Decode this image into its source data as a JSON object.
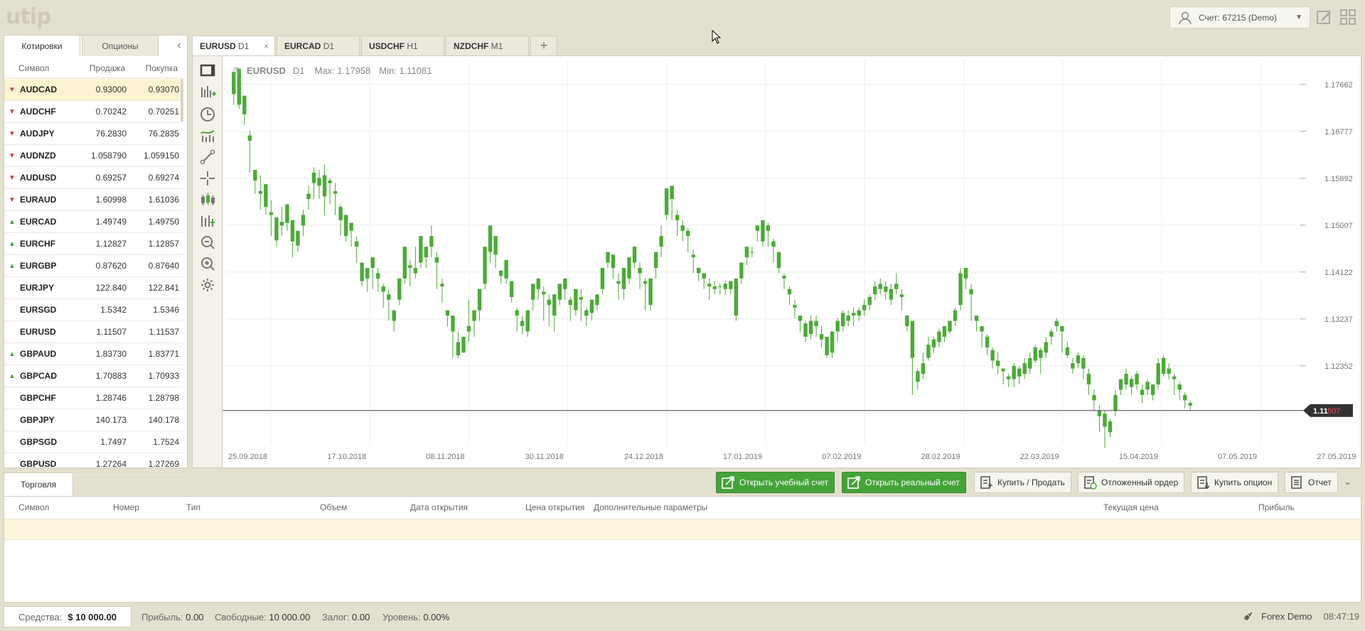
{
  "app": {
    "logo": "utip"
  },
  "account": {
    "label": "Счет: 67215 (Demo)"
  },
  "left_tabs": [
    "Котировки",
    "Опционы"
  ],
  "quotes_header": {
    "symbol": "Символ",
    "sell": "Продажа",
    "buy": "Покупка"
  },
  "quotes": [
    {
      "symbol": "AUDCAD",
      "sell": "0.93000",
      "buy": "0.93070",
      "dir": "down"
    },
    {
      "symbol": "AUDCHF",
      "sell": "0.70242",
      "buy": "0.70251",
      "dir": "down"
    },
    {
      "symbol": "AUDJPY",
      "sell": "76.2830",
      "buy": "76.2835",
      "dir": "down"
    },
    {
      "symbol": "AUDNZD",
      "sell": "1.058790",
      "buy": "1.059150",
      "dir": "down"
    },
    {
      "symbol": "AUDUSD",
      "sell": "0.69257",
      "buy": "0.69274",
      "dir": "down"
    },
    {
      "symbol": "EURAUD",
      "sell": "1.60998",
      "buy": "1.61036",
      "dir": "down"
    },
    {
      "symbol": "EURCAD",
      "sell": "1.49749",
      "buy": "1.49750",
      "dir": "up"
    },
    {
      "symbol": "EURCHF",
      "sell": "1.12827",
      "buy": "1.12857",
      "dir": "up"
    },
    {
      "symbol": "EURGBP",
      "sell": "0.87620",
      "buy": "0.87640",
      "dir": "up"
    },
    {
      "symbol": "EURJPY",
      "sell": "122.840",
      "buy": "122.841",
      "dir": ""
    },
    {
      "symbol": "EURSGD",
      "sell": "1.5342",
      "buy": "1.5346",
      "dir": ""
    },
    {
      "symbol": "EURUSD",
      "sell": "1.11507",
      "buy": "1.11537",
      "dir": ""
    },
    {
      "symbol": "GBPAUD",
      "sell": "1.83730",
      "buy": "1.83771",
      "dir": "up"
    },
    {
      "symbol": "GBPCAD",
      "sell": "1.70883",
      "buy": "1.70933",
      "dir": "up"
    },
    {
      "symbol": "GBPCHF",
      "sell": "1.28746",
      "buy": "1.28798",
      "dir": ""
    },
    {
      "symbol": "GBPJPY",
      "sell": "140.173",
      "buy": "140.178",
      "dir": ""
    },
    {
      "symbol": "GBPSGD",
      "sell": "1.7497",
      "buy": "1.7524",
      "dir": ""
    },
    {
      "symbol": "GBPUSD",
      "sell": "1.27264",
      "buy": "1.27269",
      "dir": ""
    }
  ],
  "chart_tabs": [
    {
      "symbol": "EURUSD",
      "tf": "D1"
    },
    {
      "symbol": "EURCAD",
      "tf": "D1"
    },
    {
      "symbol": "USDCHF",
      "tf": "H1"
    },
    {
      "symbol": "NZDCHF",
      "tf": "M1"
    }
  ],
  "chart_tab_close": "×",
  "chart_tab_add": "+",
  "chart_header": {
    "symbol": "EURUSD",
    "tf": "D1",
    "max": "Max: 1.17958",
    "min": "Min: 1.11081"
  },
  "current_price": {
    "main": "1.11",
    "pips": "507",
    "value": 1.11507
  },
  "chart_data": {
    "type": "candlestick",
    "symbol": "EURUSD",
    "timeframe": "D1",
    "ylim": [
      1.1086,
      1.1813
    ],
    "y_ticks": [
      "1.17662",
      "1.16777",
      "1.15892",
      "1.15007",
      "1.14122",
      "1.13237",
      "1.12352"
    ],
    "x_ticks": [
      "25.09.2018",
      "17.10.2018",
      "08.11.2018",
      "30.11.2018",
      "24.12.2018",
      "17.01.2019",
      "07.02.2019",
      "28.02.2019",
      "22.03.2019",
      "15.04.2019",
      "07.05.2019",
      "27.05.2019"
    ],
    "candles": [
      [
        1.1748,
        1.179,
        1.174,
        1.1728
      ],
      [
        1.1728,
        1.1796,
        1.1736,
        1.172
      ],
      [
        1.171,
        1.1745,
        1.174,
        1.169
      ],
      [
        1.166,
        1.167,
        1.1679,
        1.16
      ],
      [
        1.1585,
        1.1605,
        1.1602,
        1.156
      ],
      [
        1.156,
        1.1565,
        1.1595,
        1.153
      ],
      [
        1.1535,
        1.1578,
        1.1545,
        1.152
      ],
      [
        1.152,
        1.1525,
        1.1548,
        1.148
      ],
      [
        1.1472,
        1.1515,
        1.1475,
        1.146
      ],
      [
        1.15,
        1.1507,
        1.1535,
        1.148
      ],
      [
        1.1505,
        1.154,
        1.151,
        1.149
      ],
      [
        1.147,
        1.151,
        1.1485,
        1.144
      ],
      [
        1.1462,
        1.149,
        1.1475,
        1.145
      ],
      [
        1.15,
        1.152,
        1.153,
        1.148
      ],
      [
        1.155,
        1.156,
        1.1575,
        1.153
      ],
      [
        1.158,
        1.16,
        1.161,
        1.155
      ],
      [
        1.1575,
        1.159,
        1.1605,
        1.155
      ],
      [
        1.1555,
        1.1595,
        1.1615,
        1.152
      ],
      [
        1.158,
        1.1585,
        1.159,
        1.154
      ],
      [
        1.156,
        1.1565,
        1.158,
        1.152
      ],
      [
        1.151,
        1.1535,
        1.154,
        1.148
      ],
      [
        1.148,
        1.152,
        1.1495,
        1.147
      ],
      [
        1.149,
        1.1505,
        1.1495,
        1.146
      ],
      [
        1.146,
        1.147,
        1.148,
        1.143
      ],
      [
        1.1395,
        1.143,
        1.143,
        1.1385
      ],
      [
        1.14,
        1.142,
        1.1405,
        1.1375
      ],
      [
        1.142,
        1.144,
        1.142,
        1.138
      ],
      [
        1.14,
        1.141,
        1.142,
        1.1375
      ],
      [
        1.1375,
        1.1385,
        1.139,
        1.1345
      ],
      [
        1.136,
        1.137,
        1.138,
        1.132
      ],
      [
        1.132,
        1.134,
        1.133,
        1.13
      ],
      [
        1.136,
        1.14,
        1.1365,
        1.135
      ],
      [
        1.14,
        1.146,
        1.141,
        1.139
      ],
      [
        1.142,
        1.1425,
        1.1435,
        1.1385
      ],
      [
        1.141,
        1.142,
        1.146,
        1.14
      ],
      [
        1.143,
        1.148,
        1.1435,
        1.142
      ],
      [
        1.144,
        1.146,
        1.1455,
        1.142
      ],
      [
        1.146,
        1.148,
        1.15,
        1.144
      ],
      [
        1.143,
        1.144,
        1.145,
        1.138
      ],
      [
        1.1385,
        1.139,
        1.14,
        1.1355
      ],
      [
        1.133,
        1.134,
        1.134,
        1.131
      ],
      [
        1.13,
        1.133,
        1.131,
        1.125
      ],
      [
        1.1255,
        1.128,
        1.13,
        1.125
      ],
      [
        1.126,
        1.129,
        1.127,
        1.126
      ],
      [
        1.13,
        1.131,
        1.136,
        1.128
      ],
      [
        1.132,
        1.134,
        1.133,
        1.129
      ],
      [
        1.134,
        1.138,
        1.135,
        1.132
      ],
      [
        1.139,
        1.146,
        1.14,
        1.138
      ],
      [
        1.145,
        1.15,
        1.1455,
        1.143
      ],
      [
        1.1445,
        1.148,
        1.145,
        1.142
      ],
      [
        1.1405,
        1.1415,
        1.1415,
        1.139
      ],
      [
        1.14,
        1.1435,
        1.142,
        1.139
      ],
      [
        1.1365,
        1.1395,
        1.138,
        1.1355
      ],
      [
        1.133,
        1.134,
        1.1345,
        1.13
      ],
      [
        1.131,
        1.132,
        1.133,
        1.1295
      ],
      [
        1.13,
        1.134,
        1.131,
        1.129
      ],
      [
        1.136,
        1.139,
        1.137,
        1.134
      ],
      [
        1.138,
        1.14,
        1.139,
        1.136
      ],
      [
        1.137,
        1.1375,
        1.1385,
        1.132
      ],
      [
        1.135,
        1.136,
        1.137,
        1.131
      ],
      [
        1.133,
        1.137,
        1.134,
        1.13
      ],
      [
        1.136,
        1.139,
        1.1375,
        1.135
      ],
      [
        1.138,
        1.14,
        1.139,
        1.136
      ],
      [
        1.135,
        1.136,
        1.1365,
        1.132
      ],
      [
        1.134,
        1.138,
        1.135,
        1.133
      ],
      [
        1.136,
        1.1365,
        1.138,
        1.132
      ],
      [
        1.133,
        1.134,
        1.1345,
        1.131
      ],
      [
        1.1335,
        1.136,
        1.134,
        1.132
      ],
      [
        1.135,
        1.137,
        1.137,
        1.134
      ],
      [
        1.138,
        1.142,
        1.1395,
        1.137
      ],
      [
        1.143,
        1.145,
        1.144,
        1.142
      ],
      [
        1.142,
        1.1445,
        1.143,
        1.14
      ],
      [
        1.139,
        1.1395,
        1.141,
        1.136
      ],
      [
        1.138,
        1.142,
        1.139,
        1.136
      ],
      [
        1.14,
        1.144,
        1.141,
        1.139
      ],
      [
        1.143,
        1.146,
        1.144,
        1.142
      ],
      [
        1.141,
        1.142,
        1.143,
        1.138
      ],
      [
        1.139,
        1.1395,
        1.14,
        1.134
      ],
      [
        1.135,
        1.14,
        1.136,
        1.134
      ],
      [
        1.142,
        1.145,
        1.143,
        1.14
      ],
      [
        1.146,
        1.148,
        1.15,
        1.144
      ],
      [
        1.152,
        1.157,
        1.153,
        1.151
      ],
      [
        1.155,
        1.1575,
        1.156,
        1.151
      ],
      [
        1.151,
        1.152,
        1.153,
        1.148
      ],
      [
        1.149,
        1.15,
        1.151,
        1.147
      ],
      [
        1.148,
        1.149,
        1.1495,
        1.145
      ],
      [
        1.144,
        1.1445,
        1.1455,
        1.141
      ],
      [
        1.141,
        1.142,
        1.142,
        1.1395
      ],
      [
        1.14,
        1.141,
        1.141,
        1.138
      ],
      [
        1.1385,
        1.139,
        1.14,
        1.136
      ],
      [
        1.138,
        1.1385,
        1.1395,
        1.137
      ],
      [
        1.1385,
        1.1385,
        1.139,
        1.137
      ],
      [
        1.138,
        1.139,
        1.1395,
        1.137
      ],
      [
        1.138,
        1.1395,
        1.139,
        1.137
      ],
      [
        1.133,
        1.14,
        1.134,
        1.132
      ],
      [
        1.14,
        1.143,
        1.141,
        1.139
      ],
      [
        1.144,
        1.146,
        1.145,
        1.1425
      ],
      [
        1.145,
        1.145,
        1.146,
        1.144
      ],
      [
        1.149,
        1.15,
        1.15,
        1.147
      ],
      [
        1.147,
        1.151,
        1.148,
        1.146
      ],
      [
        1.149,
        1.15,
        1.1505,
        1.146
      ],
      [
        1.146,
        1.147,
        1.1475,
        1.143
      ],
      [
        1.142,
        1.145,
        1.143,
        1.141
      ],
      [
        1.14,
        1.1405,
        1.141,
        1.138
      ],
      [
        1.137,
        1.138,
        1.1385,
        1.135
      ],
      [
        1.1345,
        1.135,
        1.136,
        1.1325
      ],
      [
        1.132,
        1.133,
        1.133,
        1.13
      ],
      [
        1.129,
        1.1315,
        1.132,
        1.128
      ],
      [
        1.1295,
        1.132,
        1.133,
        1.1285
      ],
      [
        1.131,
        1.132,
        1.133,
        1.129
      ],
      [
        1.1285,
        1.1295,
        1.131,
        1.127
      ],
      [
        1.1255,
        1.129,
        1.126,
        1.125
      ],
      [
        1.126,
        1.13,
        1.127,
        1.125
      ],
      [
        1.13,
        1.132,
        1.1325,
        1.128
      ],
      [
        1.131,
        1.1335,
        1.134,
        1.13
      ],
      [
        1.132,
        1.133,
        1.134,
        1.131
      ],
      [
        1.133,
        1.1335,
        1.1345,
        1.131
      ],
      [
        1.133,
        1.134,
        1.1345,
        1.132
      ],
      [
        1.134,
        1.135,
        1.136,
        1.133
      ],
      [
        1.135,
        1.1365,
        1.137,
        1.134
      ],
      [
        1.137,
        1.1385,
        1.1395,
        1.136
      ],
      [
        1.138,
        1.139,
        1.14,
        1.137
      ],
      [
        1.1375,
        1.1385,
        1.1395,
        1.136
      ],
      [
        1.136,
        1.138,
        1.139,
        1.135
      ],
      [
        1.138,
        1.139,
        1.141,
        1.137
      ],
      [
        1.1365,
        1.137,
        1.138,
        1.134
      ],
      [
        1.131,
        1.133,
        1.133,
        1.13
      ],
      [
        1.125,
        1.132,
        1.127,
        1.118
      ],
      [
        1.1205,
        1.1225,
        1.123,
        1.119
      ],
      [
        1.122,
        1.124,
        1.126,
        1.121
      ],
      [
        1.125,
        1.1275,
        1.129,
        1.1245
      ],
      [
        1.127,
        1.1285,
        1.129,
        1.126
      ],
      [
        1.128,
        1.13,
        1.1305,
        1.127
      ],
      [
        1.129,
        1.131,
        1.131,
        1.128
      ],
      [
        1.13,
        1.132,
        1.132,
        1.1295
      ],
      [
        1.132,
        1.134,
        1.1345,
        1.131
      ],
      [
        1.135,
        1.141,
        1.142,
        1.134
      ],
      [
        1.14,
        1.142,
        1.142,
        1.138
      ],
      [
        1.137,
        1.138,
        1.139,
        1.132
      ],
      [
        1.132,
        1.133,
        1.133,
        1.13
      ],
      [
        1.13,
        1.131,
        1.131,
        1.127
      ],
      [
        1.127,
        1.129,
        1.1295,
        1.1255
      ],
      [
        1.1245,
        1.1265,
        1.127,
        1.123
      ],
      [
        1.1235,
        1.1245,
        1.126,
        1.122
      ],
      [
        1.1225,
        1.123,
        1.123,
        1.12
      ],
      [
        1.121,
        1.1215,
        1.122,
        1.1195
      ],
      [
        1.121,
        1.1235,
        1.124,
        1.1195
      ],
      [
        1.1215,
        1.123,
        1.1235,
        1.12
      ],
      [
        1.122,
        1.124,
        1.125,
        1.121
      ],
      [
        1.123,
        1.125,
        1.126,
        1.122
      ],
      [
        1.1245,
        1.127,
        1.1275,
        1.124
      ],
      [
        1.125,
        1.1265,
        1.127,
        1.122
      ],
      [
        1.126,
        1.128,
        1.129,
        1.125
      ],
      [
        1.129,
        1.13,
        1.1305,
        1.1275
      ],
      [
        1.131,
        1.132,
        1.1325,
        1.13
      ],
      [
        1.13,
        1.131,
        1.131,
        1.126
      ],
      [
        1.1255,
        1.127,
        1.128,
        1.125
      ],
      [
        1.123,
        1.124,
        1.125,
        1.122
      ],
      [
        1.124,
        1.1255,
        1.126,
        1.123
      ],
      [
        1.123,
        1.125,
        1.1255,
        1.121
      ],
      [
        1.12,
        1.122,
        1.123,
        1.118
      ],
      [
        1.117,
        1.118,
        1.119,
        1.115
      ],
      [
        1.114,
        1.115,
        1.116,
        1.111
      ],
      [
        1.112,
        1.1145,
        1.115,
        1.108
      ],
      [
        1.111,
        1.113,
        1.1135,
        1.11
      ],
      [
        1.115,
        1.118,
        1.119,
        1.114
      ],
      [
        1.119,
        1.121,
        1.121,
        1.118
      ],
      [
        1.12,
        1.122,
        1.123,
        1.119
      ],
      [
        1.1195,
        1.121,
        1.1215,
        1.118
      ],
      [
        1.12,
        1.122,
        1.1225,
        1.119
      ],
      [
        1.118,
        1.119,
        1.12,
        1.1165
      ],
      [
        1.119,
        1.1205,
        1.121,
        1.118
      ],
      [
        1.118,
        1.12,
        1.12,
        1.117
      ],
      [
        1.12,
        1.124,
        1.125,
        1.119
      ],
      [
        1.122,
        1.125,
        1.1255,
        1.1215
      ],
      [
        1.122,
        1.123,
        1.124,
        1.121
      ],
      [
        1.121,
        1.1215,
        1.122,
        1.118
      ],
      [
        1.119,
        1.12,
        1.1205,
        1.117
      ],
      [
        1.117,
        1.118,
        1.1185,
        1.1155
      ],
      [
        1.116,
        1.1165,
        1.117,
        1.115
      ]
    ]
  },
  "bottom_tabs": {
    "trading": "Торговля"
  },
  "actions": {
    "open_demo": "Открыть учебный счет",
    "open_real": "Открыть реальный счет",
    "buy_sell": "Купить / Продать",
    "pending": "Отложенный ордер",
    "buy_option": "Купить опцион",
    "report": "Отчет"
  },
  "trade_columns": [
    "Символ",
    "Номер",
    "Тип",
    "Объем",
    "Дата открытия",
    "Цена открытия",
    "Дополнительные параметры",
    "Текущая цена",
    "Прибыль"
  ],
  "status": {
    "funds_label": "Средства:",
    "funds_value": "$ 10 000.00",
    "profit_label": "Прибыль:",
    "profit_value": "0.00",
    "free_label": "Свободные:",
    "free_value": "10 000.00",
    "margin_label": "Залог:",
    "margin_value": "0.00",
    "level_label": "Уровень:",
    "level_value": "0.00%",
    "server": "Forex Demo",
    "time": "08:47:19"
  },
  "colors": {
    "up": "#4caa38",
    "down": "#d93c3c",
    "accent_green": "#45a33a",
    "bg": "#e4e0d0"
  },
  "icons": {
    "user": "user-icon",
    "edit": "edit-icon",
    "grid": "layout-grid-icon",
    "toolbar": [
      "single-chart-icon",
      "add-indicator-icon",
      "timeframe-clock-icon",
      "indicators-icon",
      "trendline-icon",
      "crosshair-icon",
      "candles-type-icon",
      "chart-type-icon",
      "zoom-out-icon",
      "zoom-in-icon",
      "settings-gear-icon"
    ]
  }
}
